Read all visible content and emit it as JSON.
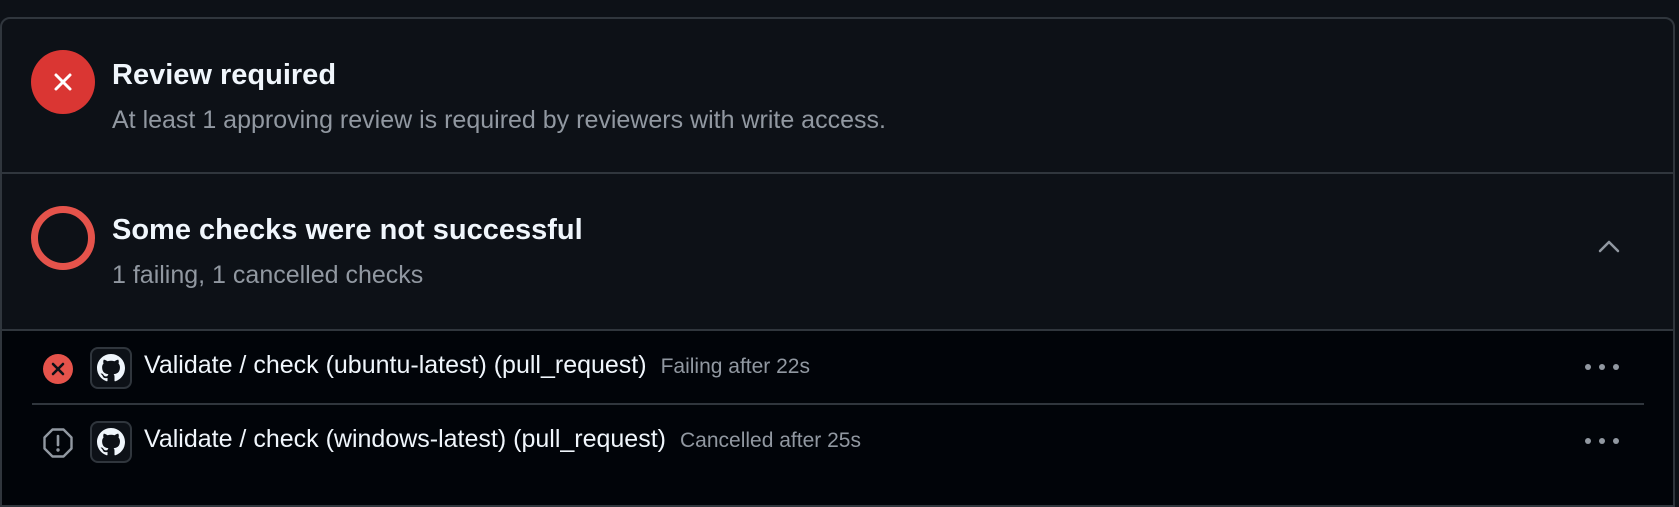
{
  "review": {
    "title": "Review required",
    "subtitle": "At least 1 approving review is required by reviewers with write access.",
    "status_icon": "x-circle-fill-icon",
    "status_color": "#da3633"
  },
  "checks": {
    "title": "Some checks were not successful",
    "subtitle": "1 failing, 1 cancelled checks",
    "status_icon": "ring-icon",
    "status_color": "#e5534b",
    "collapse_icon": "chevron-up-icon",
    "items": [
      {
        "name": "Validate / check (ubuntu-latest) (pull_request)",
        "status": "Failing after 22s",
        "status_icon": "x-circle-fill-icon",
        "app_icon": "github-icon",
        "more_icon": "kebab-horizontal-icon"
      },
      {
        "name": "Validate / check (windows-latest) (pull_request)",
        "status": "Cancelled after 25s",
        "status_icon": "stop-icon",
        "app_icon": "github-icon",
        "more_icon": "kebab-horizontal-icon"
      }
    ]
  },
  "colors": {
    "background": "#0d1117",
    "list_background": "#010409",
    "border": "#30363d",
    "text": "#f0f6fc",
    "muted": "#9198a1",
    "danger": "#da3633"
  }
}
